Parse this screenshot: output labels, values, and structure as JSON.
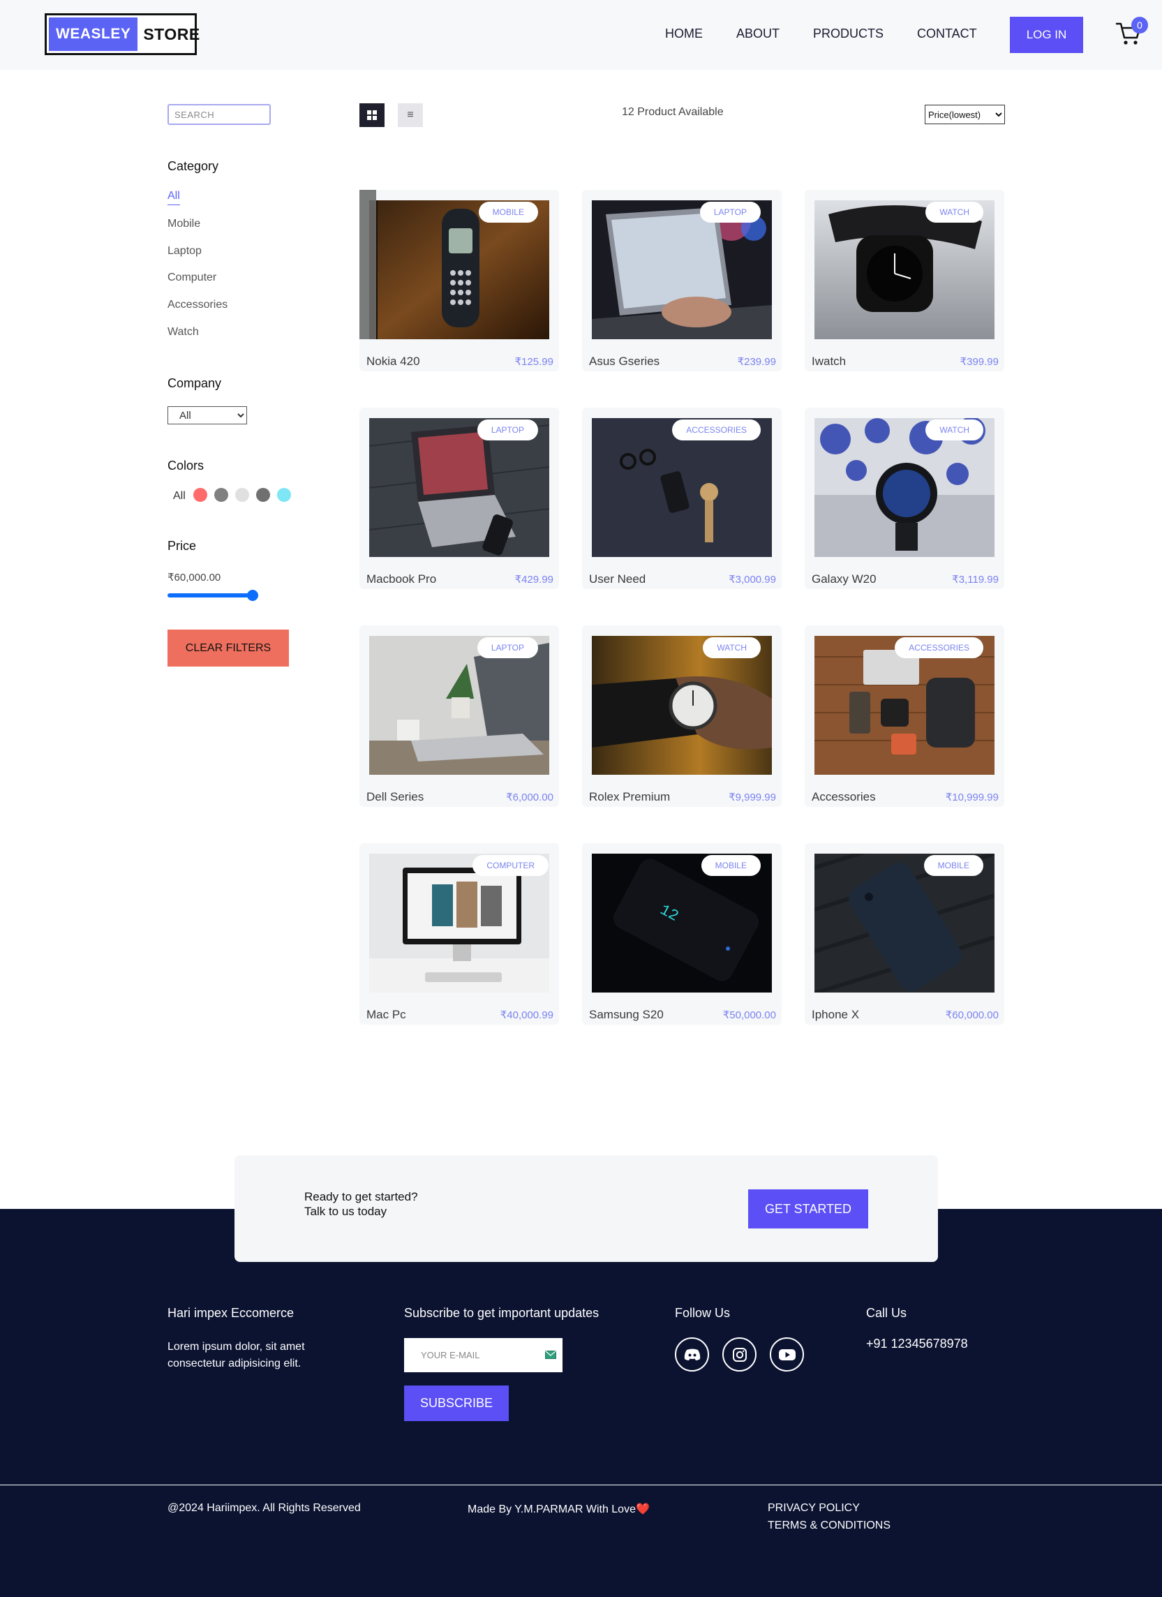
{
  "header": {
    "logo_part1": "WEASLEY",
    "logo_part2": "STORE",
    "nav": [
      "HOME",
      "ABOUT",
      "PRODUCTS",
      "CONTACT"
    ],
    "login_label": "LOG IN",
    "cart_count": "0",
    "accent_color": "#5b4ff5"
  },
  "sidebar": {
    "search_placeholder": "SEARCH",
    "category_title": "Category",
    "categories": [
      "All",
      "Mobile",
      "Laptop",
      "Computer",
      "Accessories",
      "Watch"
    ],
    "active_category": "All",
    "company_title": "Company",
    "company_selected": "All",
    "colors_title": "Colors",
    "colors_all_label": "All",
    "colors": [
      "#ff6b6b",
      "#808080",
      "#e0e0e0",
      "#707070",
      "#7ee6f5"
    ],
    "price_title": "Price",
    "price_value": "₹60,000.00",
    "price_slider_fraction": 1.0,
    "clear_label": "CLEAR FILTERS"
  },
  "toolbar": {
    "count_text": "12 Product Available",
    "sort_selected": "Price(lowest)",
    "list_icon_glyph": "≡"
  },
  "products": [
    {
      "name": "Nokia 420",
      "price": "₹125.99",
      "category": "MOBILE"
    },
    {
      "name": "Asus Gseries",
      "price": "₹239.99",
      "category": "LAPTOP"
    },
    {
      "name": "Iwatch",
      "price": "₹399.99",
      "category": "WATCH"
    },
    {
      "name": "Macbook Pro",
      "price": "₹429.99",
      "category": "LAPTOP"
    },
    {
      "name": "User Need",
      "price": "₹3,000.99",
      "category": "ACCESSORIES"
    },
    {
      "name": "Galaxy W20",
      "price": "₹3,119.99",
      "category": "WATCH"
    },
    {
      "name": "Dell Series",
      "price": "₹6,000.00",
      "category": "LAPTOP"
    },
    {
      "name": "Rolex Premium",
      "price": "₹9,999.99",
      "category": "WATCH"
    },
    {
      "name": "Accessories",
      "price": "₹10,999.99",
      "category": "ACCESSORIES"
    },
    {
      "name": "Mac Pc",
      "price": "₹40,000.99",
      "category": "COMPUTER"
    },
    {
      "name": "Samsung S20",
      "price": "₹50,000.00",
      "category": "MOBILE"
    },
    {
      "name": "Iphone X",
      "price": "₹60,000.00",
      "category": "MOBILE"
    }
  ],
  "cta": {
    "line1": "Ready to get started?",
    "line2": "Talk to us today",
    "button": "GET STARTED"
  },
  "footer": {
    "about_title": "Hari impex Eccomerce",
    "about_text": "Lorem ipsum dolor, sit amet consectetur adipisicing elit.",
    "subscribe_title": "Subscribe to get important updates",
    "email_placeholder": "YOUR E-MAIL",
    "subscribe_button": "SUBSCRIBE",
    "follow_title": "Follow Us",
    "social_icons": [
      "discord-icon",
      "instagram-icon",
      "youtube-icon"
    ],
    "call_title": "Call Us",
    "phone": "+91 12345678978",
    "copyright": "@2024 Hariimpex. All Rights Reserved",
    "made_by": "Made By Y.M.PARMAR With Love❤️",
    "privacy": "PRIVACY POLICY",
    "terms": "TERMS & CONDITIONS"
  }
}
